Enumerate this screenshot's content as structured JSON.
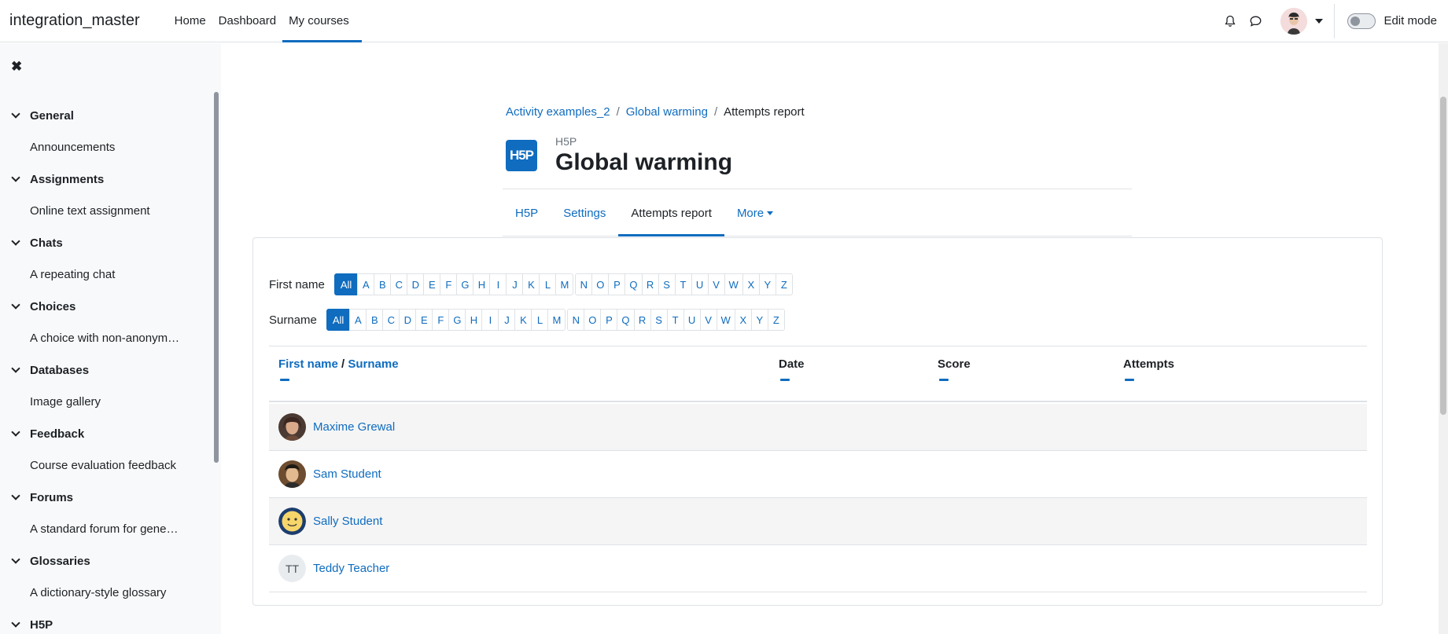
{
  "navbar": {
    "brand": "integration_master",
    "items": [
      {
        "label": "Home"
      },
      {
        "label": "Dashboard"
      },
      {
        "label": "My courses"
      }
    ],
    "edit_mode_label": "Edit mode",
    "icons": [
      "bell-icon",
      "chat-icon",
      "avatar",
      "chevron-down-icon"
    ]
  },
  "drawer": {
    "close_icon": "close-icon",
    "sections": [
      {
        "title": "General",
        "item": "Announcements"
      },
      {
        "title": "Assignments",
        "item": "Online text assignment"
      },
      {
        "title": "Chats",
        "item": "A repeating chat"
      },
      {
        "title": "Choices",
        "item": "A choice with non-anonym…"
      },
      {
        "title": "Databases",
        "item": "Image gallery"
      },
      {
        "title": "Feedback",
        "item": "Course evaluation feedback"
      },
      {
        "title": "Forums",
        "item": "A standard forum for gene…"
      },
      {
        "title": "Glossaries",
        "item": "A dictionary-style glossary"
      },
      {
        "title": "H5P"
      }
    ]
  },
  "breadcrumb": [
    "Activity examples_2",
    "Global warming",
    "Attempts report"
  ],
  "header": {
    "icon_text": "H5P",
    "module_type": "H5P",
    "title": "Global warming"
  },
  "tabs": [
    {
      "label": "H5P"
    },
    {
      "label": "Settings"
    },
    {
      "label": "Attempts report"
    },
    {
      "label": "More"
    }
  ],
  "filters": {
    "first_name_label": "First name",
    "surname_label": "Surname",
    "all_label": "All",
    "letters_a_m": [
      "A",
      "B",
      "C",
      "D",
      "E",
      "F",
      "G",
      "H",
      "I",
      "J",
      "K",
      "L",
      "M"
    ],
    "letters_n_z": [
      "N",
      "O",
      "P",
      "Q",
      "R",
      "S",
      "T",
      "U",
      "V",
      "W",
      "X",
      "Y",
      "Z"
    ]
  },
  "table": {
    "col_first_name": "First name",
    "col_slash": "/",
    "col_surname": "Surname",
    "col_date": "Date",
    "col_score": "Score",
    "col_attempts": "Attempts",
    "rows": [
      {
        "name": "Maxime Grewal"
      },
      {
        "name": "Sam Student"
      },
      {
        "name": "Sally Student"
      },
      {
        "name": "Teddy Teacher",
        "initials": "TT"
      }
    ]
  },
  "colors": {
    "accent": "#0f6cbf",
    "text": "#1d2125",
    "drawer_bg": "#f8f9fa"
  }
}
